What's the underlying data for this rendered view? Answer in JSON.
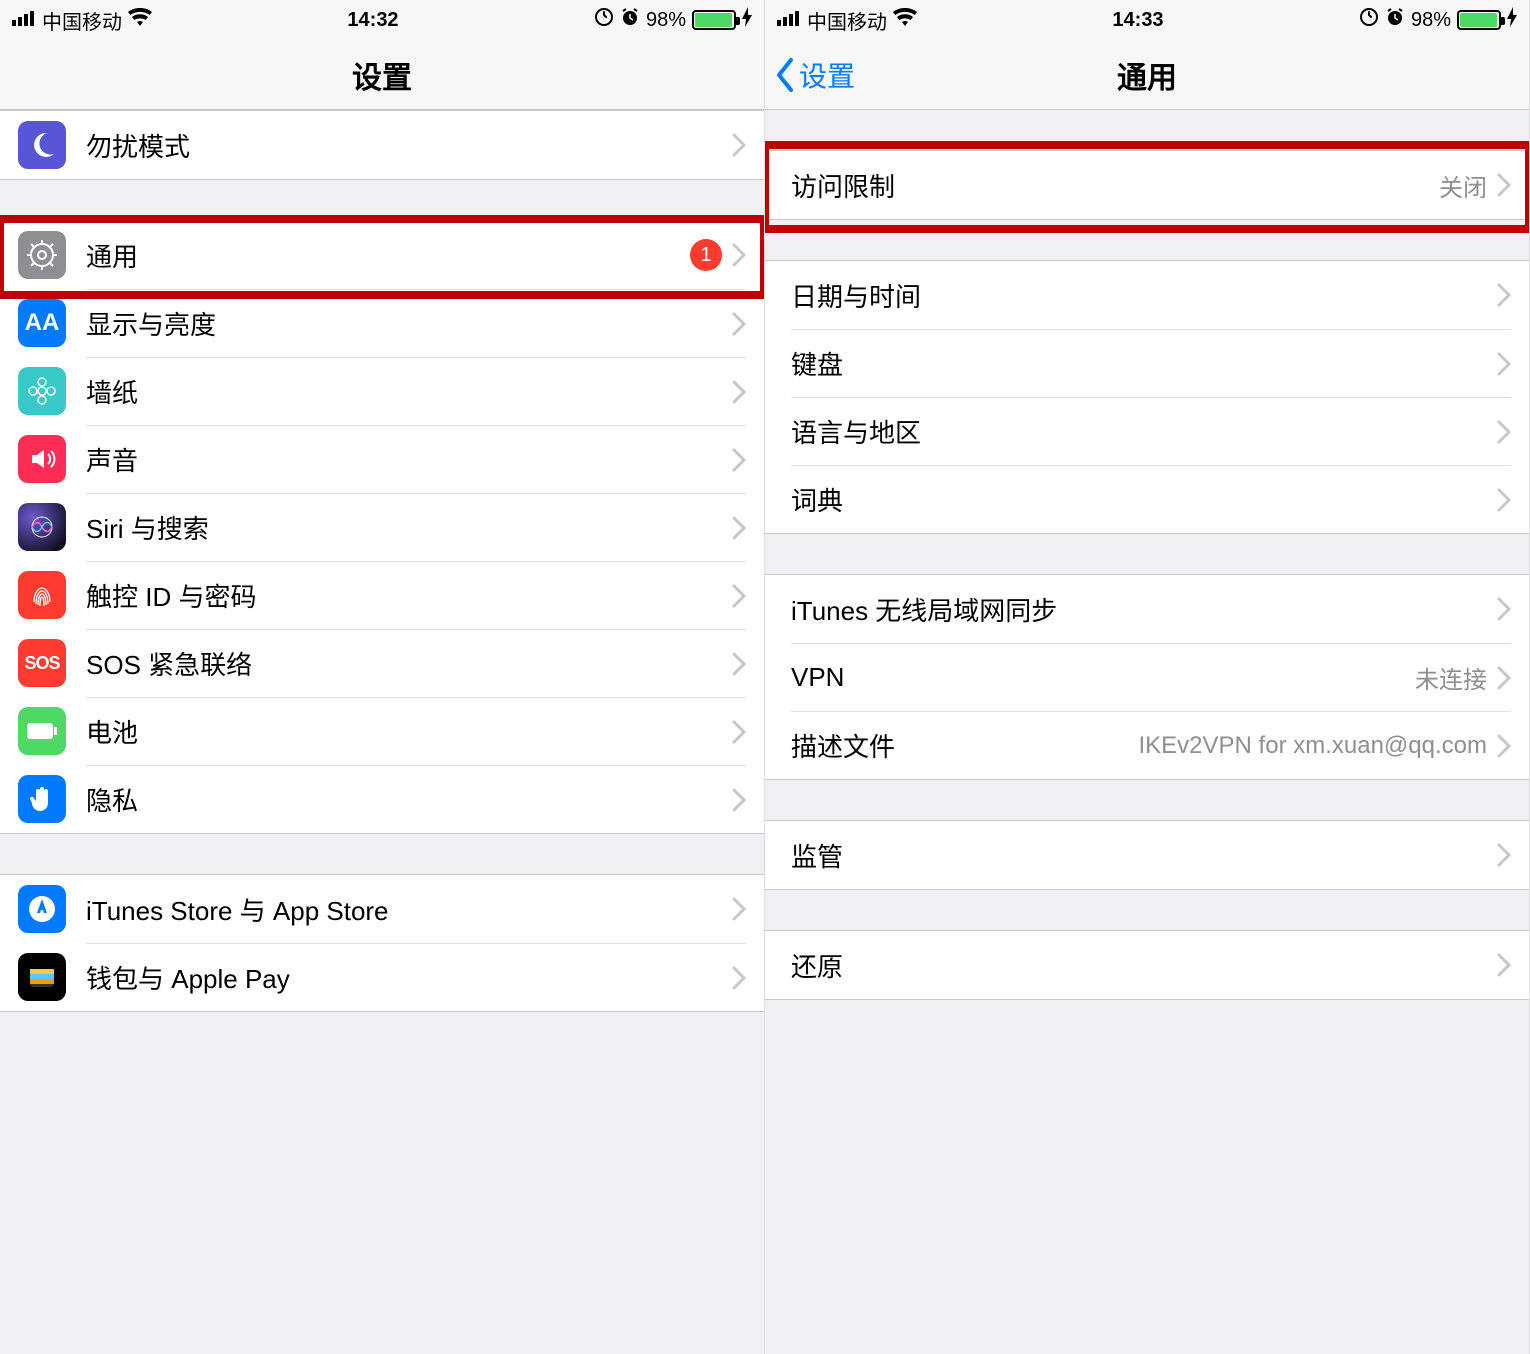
{
  "left": {
    "status": {
      "carrier": "中国移动",
      "time": "14:32",
      "battery_pct": "98%"
    },
    "nav": {
      "title": "设置"
    },
    "sections": [
      {
        "rows": [
          {
            "id": "dnd",
            "label": "勿扰模式"
          }
        ]
      },
      {
        "rows": [
          {
            "id": "general",
            "label": "通用",
            "badge": "1"
          },
          {
            "id": "display",
            "label": "显示与亮度"
          },
          {
            "id": "wallpaper",
            "label": "墙纸"
          },
          {
            "id": "sound",
            "label": "声音"
          },
          {
            "id": "siri",
            "label": "Siri 与搜索"
          },
          {
            "id": "touchid",
            "label": "触控 ID 与密码"
          },
          {
            "id": "sos",
            "label": "SOS 紧急联络"
          },
          {
            "id": "battery",
            "label": "电池"
          },
          {
            "id": "privacy",
            "label": "隐私"
          }
        ]
      },
      {
        "rows": [
          {
            "id": "itunes",
            "label": "iTunes Store 与 App Store"
          },
          {
            "id": "wallet",
            "label": "钱包与 Apple Pay"
          }
        ]
      }
    ]
  },
  "right": {
    "status": {
      "carrier": "中国移动",
      "time": "14:33",
      "battery_pct": "98%"
    },
    "nav": {
      "back": "设置",
      "title": "通用"
    },
    "sections": [
      {
        "rows": [
          {
            "id": "restrictions",
            "label": "访问限制",
            "detail": "关闭"
          }
        ]
      },
      {
        "rows": [
          {
            "id": "datetime",
            "label": "日期与时间"
          },
          {
            "id": "keyboard",
            "label": "键盘"
          },
          {
            "id": "lang",
            "label": "语言与地区"
          },
          {
            "id": "dict",
            "label": "词典"
          }
        ]
      },
      {
        "rows": [
          {
            "id": "itunes-sync",
            "label": "iTunes 无线局域网同步"
          },
          {
            "id": "vpn",
            "label": "VPN",
            "detail": "未连接"
          },
          {
            "id": "profile",
            "label": "描述文件",
            "detail": "IKEv2VPN for xm.xuan@qq.com"
          }
        ]
      },
      {
        "rows": [
          {
            "id": "supervision",
            "label": "监管"
          }
        ]
      },
      {
        "rows": [
          {
            "id": "reset",
            "label": "还原"
          }
        ]
      }
    ]
  }
}
